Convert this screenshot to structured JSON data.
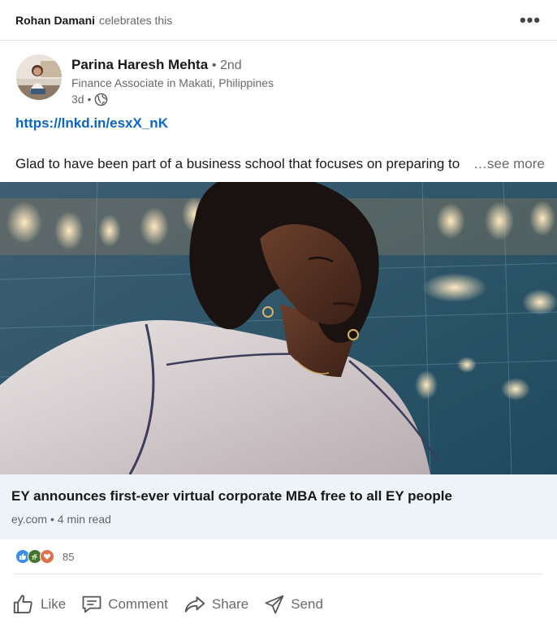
{
  "header": {
    "actor": "Rohan Damani",
    "verb": "celebrates this",
    "more_icon": "ellipsis-icon"
  },
  "author": {
    "name": "Parina Haresh Mehta",
    "degree": "• 2nd",
    "headline": "Finance Associate in Makati, Philippines",
    "time": "3d •",
    "visibility_icon": "globe-icon"
  },
  "post": {
    "link": "https://lnkd.in/esxX_nK",
    "text": "Glad to have been part of a business school that focuses on preparing to",
    "see_more": "…see more"
  },
  "article": {
    "title": "EY announces first-ever virtual corporate MBA free to all EY people",
    "meta": "ey.com • 4 min read"
  },
  "social": {
    "reactions": [
      "like-icon",
      "celebrate-icon",
      "love-icon"
    ],
    "count": "85"
  },
  "actions": [
    {
      "label": "Like",
      "icon": "thumbs-up-icon"
    },
    {
      "label": "Comment",
      "icon": "comment-icon"
    },
    {
      "label": "Share",
      "icon": "share-arrow-icon"
    },
    {
      "label": "Send",
      "icon": "send-icon"
    }
  ],
  "colors": {
    "link": "#0a66c2",
    "card_bg": "#eef3f8",
    "like": "#378fe9",
    "celebrate": "#44712e",
    "love": "#df704d"
  }
}
